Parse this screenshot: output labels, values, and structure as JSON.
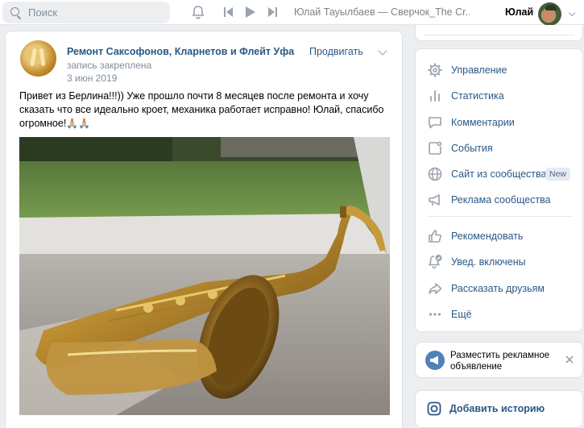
{
  "header": {
    "search_placeholder": "Поиск",
    "now_playing": "Юлай Тауылбаев — Сверчок_The Cr...",
    "user_name": "Юлай"
  },
  "post": {
    "group_name": "Ремонт Саксофонов, Кларнетов и Флейт Уфа",
    "pinned_label": "запись закреплена",
    "date": "3 июн 2019",
    "promote_label": "Продвигать",
    "text": "Привет из Берлина!!!)) Уже прошло почти 8 месяцев после ремонта и хочу сказать что все идеально кроет, механика работает исправно! Юлай, спасибо огромное!",
    "emoji": "🙏🏼🙏🏼"
  },
  "menu": {
    "items": [
      {
        "label": "Управление",
        "icon": "gear-icon"
      },
      {
        "label": "Статистика",
        "icon": "stats-icon"
      },
      {
        "label": "Комментарии",
        "icon": "comment-icon"
      },
      {
        "label": "События",
        "icon": "event-icon"
      },
      {
        "label": "Сайт из сообщества",
        "icon": "globe-icon",
        "badge": "New"
      },
      {
        "label": "Реклама сообщества",
        "icon": "megaphone-icon"
      },
      {
        "label": "Рекомендовать",
        "icon": "thumb-up-icon"
      },
      {
        "label": "Увед. включены",
        "icon": "bell-check-icon"
      },
      {
        "label": "Рассказать друзьям",
        "icon": "share-icon"
      },
      {
        "label": "Ещё",
        "icon": "more-icon"
      }
    ]
  },
  "ad": {
    "text": "Разместить рекламное объявление"
  },
  "story": {
    "label": "Добавить историю"
  },
  "colors": {
    "link": "#2a5885",
    "accent": "#5181b8",
    "muted": "#818c99",
    "background": "#edeef0"
  }
}
